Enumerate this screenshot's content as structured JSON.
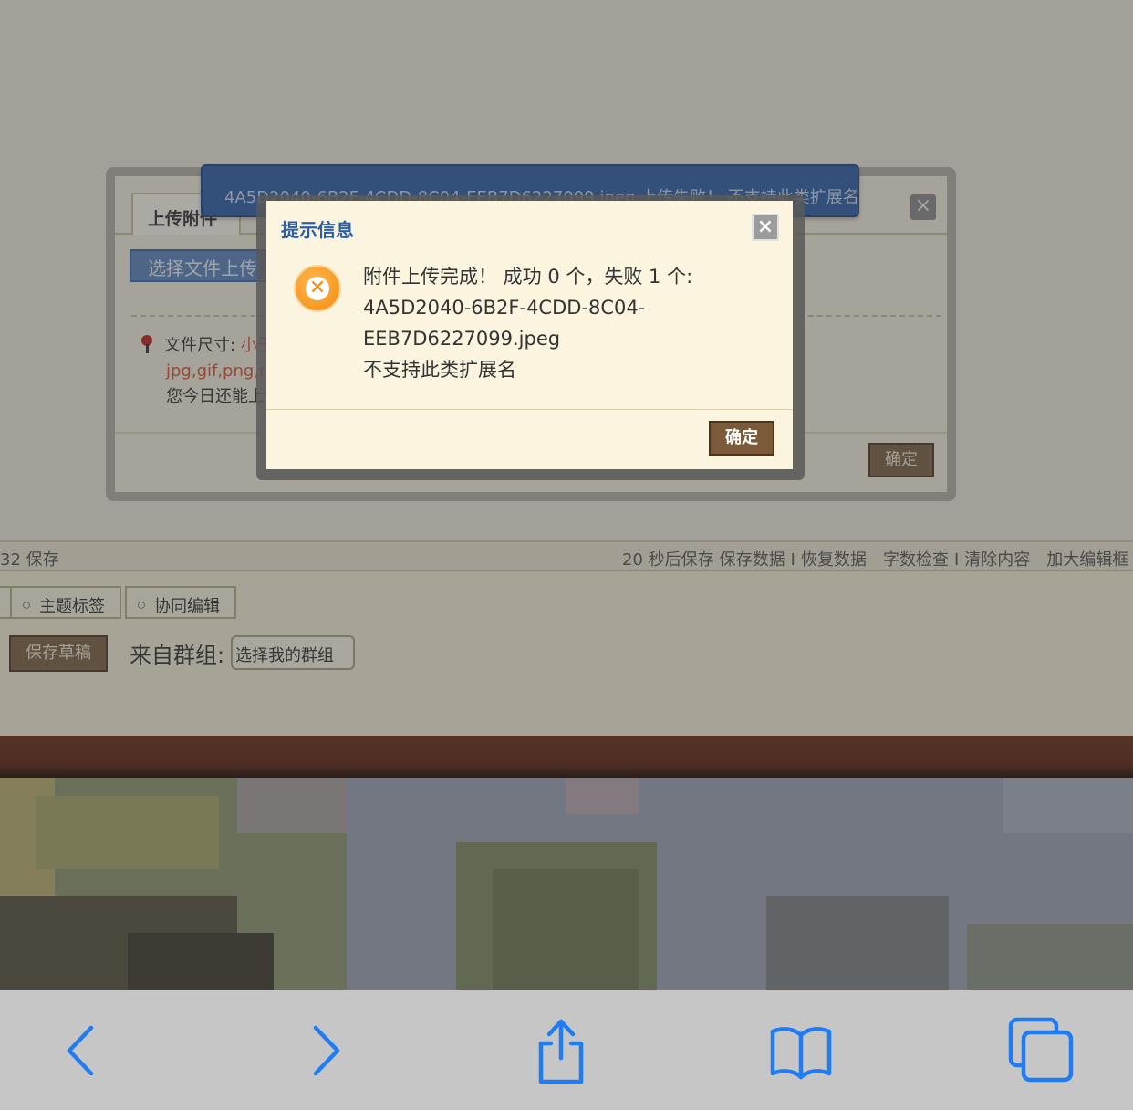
{
  "editor_bar": {
    "left_text": "32 保存",
    "autosave": "20 秒后保存",
    "save_data": "保存数据",
    "restore_data": "恢复数据",
    "word_check": "字数检查",
    "clear": "清除内容",
    "enlarge": "加大编辑框",
    "separator": "I"
  },
  "options": {
    "tab_tags": "主题标签",
    "tab_collab": "协同编辑",
    "save_draft": "保存草稿",
    "group_label": "来自群组:",
    "group_select": "选择我的群组"
  },
  "upload_dialog": {
    "tab": "上传附件",
    "upload_button": "选择文件上传",
    "size_label": "文件尺寸:",
    "size_value": "小于",
    "types": "jpg,gif,png,rar,",
    "today_limit": "您今日还能上传",
    "close": "×",
    "ok": "确定"
  },
  "toast": {
    "text": "4A5D2040-6B2F-4CDD-8C04-EEB7D6227099.jpeg 上传失败！ 不支持此类扩展名"
  },
  "alert": {
    "title": "提示信息",
    "close": "×",
    "icon": "error-x-icon",
    "line1": "附件上传完成！ 成功 0 个，失败 1 个:",
    "line2": "4A5D2040-6B2F-4CDD-8C04-",
    "line3": "EEB7D6227099.jpeg",
    "line4": "不支持此类扩展名",
    "ok": "确定"
  },
  "toolbar": {
    "back": "back-chevron-icon",
    "forward": "forward-chevron-icon",
    "share": "share-icon",
    "bookmarks": "bookmarks-book-icon",
    "tabs": "tabs-overview-icon",
    "accent": "#1f7cf2"
  }
}
